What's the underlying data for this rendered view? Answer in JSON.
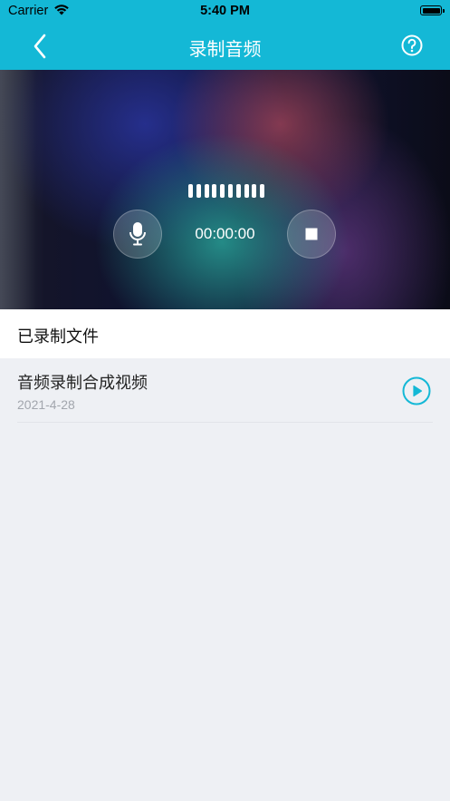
{
  "status_bar": {
    "carrier": "Carrier",
    "time": "5:40 PM"
  },
  "nav": {
    "title": "录制音频",
    "back_icon": "chevron-left-icon",
    "help_icon": "help-circle-icon"
  },
  "recorder": {
    "timer": "00:00:00",
    "level_bar_count": 10,
    "mic_icon": "microphone-icon",
    "stop_icon": "stop-icon"
  },
  "section": {
    "title": "已录制文件"
  },
  "recordings": [
    {
      "title": "音频录制合成视频",
      "date": "2021-4-28",
      "action_icon": "play-circle-icon"
    }
  ],
  "colors": {
    "accent": "#14b8d6",
    "background": "#eef0f4"
  }
}
